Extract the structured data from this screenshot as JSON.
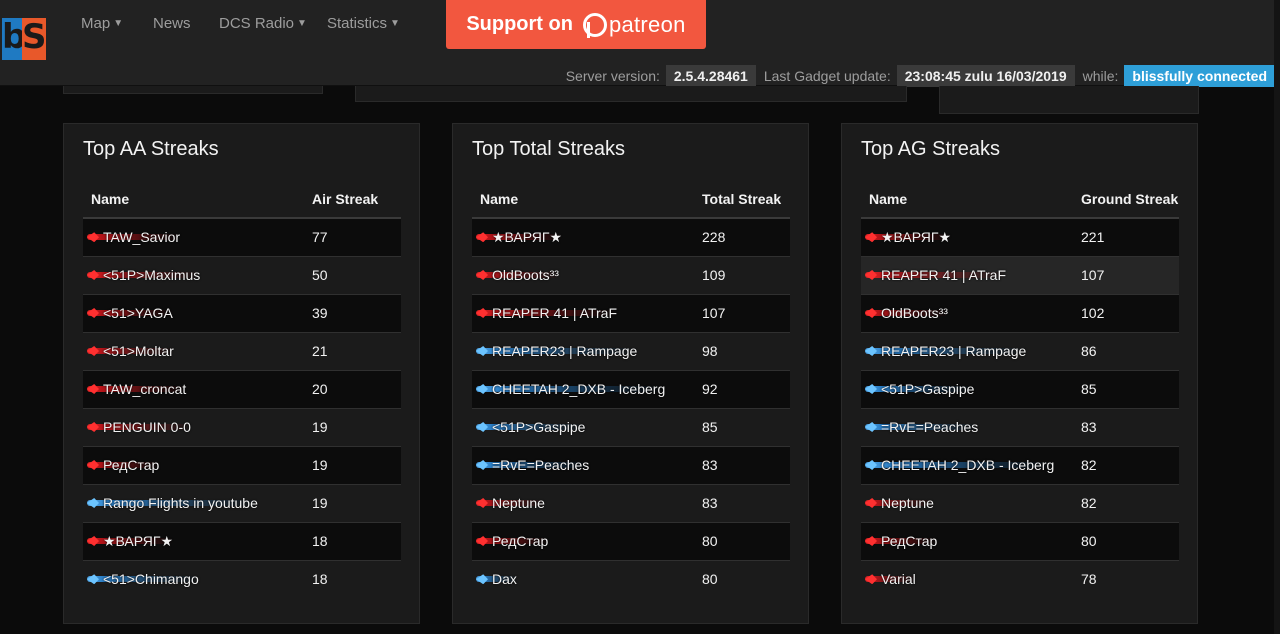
{
  "nav": {
    "logo_letters": [
      "b",
      "S"
    ],
    "items": [
      {
        "label": "Map",
        "dropdown": true
      },
      {
        "label": "News",
        "dropdown": false
      },
      {
        "label": "DCS Radio",
        "dropdown": true
      },
      {
        "label": "Statistics",
        "dropdown": true
      }
    ],
    "patreon": {
      "prefix": "Support on",
      "brand": "patreon"
    }
  },
  "status": {
    "server_label": "Server version:",
    "server_version": "2.5.4.28461",
    "gadget_label": "Last Gadget update:",
    "gadget_time": "23:08:45 zulu 16/03/2019",
    "while_label": "while:",
    "connection": "blissfully connected"
  },
  "colors": {
    "red_coalition": "#ff3030",
    "blue_coalition": "#6cc4ff",
    "connected": "#2e9fd8",
    "patreon": "#f2573f"
  },
  "panels": [
    {
      "title": "Top AA Streaks",
      "columns": [
        "Name",
        "Air Streak"
      ],
      "rows": [
        {
          "name": "TAW_Savior",
          "value": "77",
          "side": "red"
        },
        {
          "name": "<51P>Maximus",
          "value": "50",
          "side": "red"
        },
        {
          "name": "<51>YAGA",
          "value": "39",
          "side": "red"
        },
        {
          "name": "<51>Moltar",
          "value": "21",
          "side": "red"
        },
        {
          "name": "TAW_croncat",
          "value": "20",
          "side": "red"
        },
        {
          "name": "PENGUIN 0-0",
          "value": "19",
          "side": "red"
        },
        {
          "name": "РедСтар",
          "value": "19",
          "side": "red"
        },
        {
          "name": "Rango Flights in youtube",
          "value": "19",
          "side": "blue"
        },
        {
          "name": "★ВАРЯГ★",
          "value": "18",
          "side": "red"
        },
        {
          "name": "<51>Chimango",
          "value": "18",
          "side": "blue"
        }
      ]
    },
    {
      "title": "Top Total Streaks",
      "columns": [
        "Name",
        "Total Streak"
      ],
      "rows": [
        {
          "name": "★ВАРЯГ★",
          "value": "228",
          "side": "red"
        },
        {
          "name": "OldBoots³³",
          "value": "109",
          "side": "red"
        },
        {
          "name": "REAPER 41 | ATraF",
          "value": "107",
          "side": "red"
        },
        {
          "name": "REAPER23 | Rampage",
          "value": "98",
          "side": "blue"
        },
        {
          "name": "CHEETAH 2_DXB - Iceberg",
          "value": "92",
          "side": "blue"
        },
        {
          "name": "<51P>Gaspipe",
          "value": "85",
          "side": "blue"
        },
        {
          "name": "=RvE=Peaches",
          "value": "83",
          "side": "blue"
        },
        {
          "name": "Neptune",
          "value": "83",
          "side": "red"
        },
        {
          "name": "РедСтар",
          "value": "80",
          "side": "red"
        },
        {
          "name": "Dax",
          "value": "80",
          "side": "blue"
        }
      ]
    },
    {
      "title": "Top AG Streaks",
      "columns": [
        "Name",
        "Ground Streak"
      ],
      "rows": [
        {
          "name": "★ВАРЯГ★",
          "value": "221",
          "side": "red"
        },
        {
          "name": "REAPER 41 | ATraF",
          "value": "107",
          "side": "red"
        },
        {
          "name": "OldBoots³³",
          "value": "102",
          "side": "red"
        },
        {
          "name": "REAPER23 | Rampage",
          "value": "86",
          "side": "blue"
        },
        {
          "name": "<51P>Gaspipe",
          "value": "85",
          "side": "blue"
        },
        {
          "name": "=RvE=Peaches",
          "value": "83",
          "side": "blue"
        },
        {
          "name": "CHEETAH 2_DXB - Iceberg",
          "value": "82",
          "side": "blue"
        },
        {
          "name": "Neptune",
          "value": "82",
          "side": "red"
        },
        {
          "name": "РедСтар",
          "value": "80",
          "side": "red"
        },
        {
          "name": "Varial",
          "value": "78",
          "side": "red"
        }
      ]
    }
  ]
}
